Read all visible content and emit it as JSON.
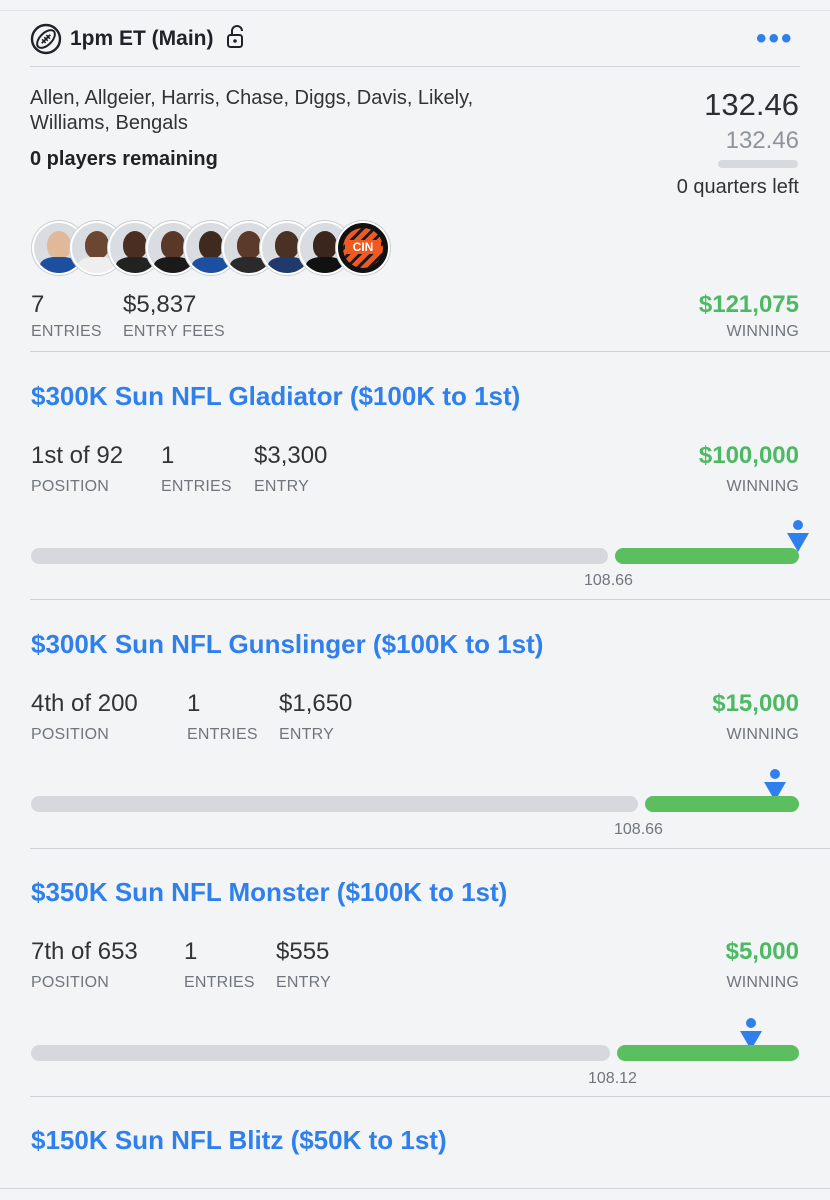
{
  "header": {
    "title": "1pm ET (Main)",
    "menu": "•••"
  },
  "lineup": {
    "players_line1": "Allen, Allgeier, Harris, Chase, Diggs, Davis, Likely,",
    "players_line2": "Williams, Bengals",
    "remaining": "0 players remaining",
    "score": "132.46",
    "projected": "132.46",
    "quarters_left": "0 quarters left",
    "team_logo_text": "CIN",
    "entries_value": "7",
    "entries_label": "ENTRIES",
    "fees_value": "$5,837",
    "fees_label": "ENTRY FEES",
    "winning_value": "$121,075",
    "winning_label": "WINNING"
  },
  "contests": [
    {
      "title": "$300K Sun NFL Gladiator ($100K to 1st)",
      "position": "1st of 92",
      "position_label": "POSITION",
      "entries": "1",
      "entries_label": "ENTRIES",
      "entry": "$3,300",
      "entry_label": "ENTRY",
      "winning": "$100,000",
      "winning_label": "WINNING",
      "cutoff": "108.66"
    },
    {
      "title": "$300K Sun NFL Gunslinger ($100K to 1st)",
      "position": "4th of 200",
      "position_label": "POSITION",
      "entries": "1",
      "entries_label": "ENTRIES",
      "entry": "$1,650",
      "entry_label": "ENTRY",
      "winning": "$15,000",
      "winning_label": "WINNING",
      "cutoff": "108.66"
    },
    {
      "title": "$350K Sun NFL Monster ($100K to 1st)",
      "position": "7th of 653",
      "position_label": "POSITION",
      "entries": "1",
      "entries_label": "ENTRIES",
      "entry": "$555",
      "entry_label": "ENTRY",
      "winning": "$5,000",
      "winning_label": "WINNING",
      "cutoff": "108.12"
    },
    {
      "title": "$150K Sun NFL Blitz ($50K to 1st)"
    }
  ],
  "colors": {
    "accent_blue": "#2f80ed",
    "winning_green": "#4cb963",
    "bar_green": "#5cbf5f",
    "bar_grey": "#d5d8dc"
  }
}
